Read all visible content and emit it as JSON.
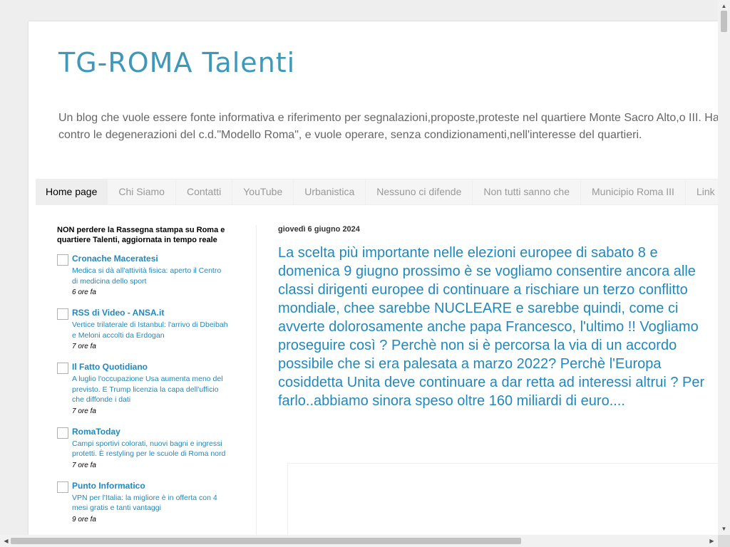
{
  "header": {
    "title": "TG-ROMA Talenti",
    "description": "Un blog che vuole essere fonte informativa e riferimento per segnalazioni,proposte,proteste nel quartiere Monte Sacro Alto,o III. Ha combattuto contro le degenerazioni del c.d.\"Modello Roma\", e vuole operare, senza condizionamenti,nell'interesse del quartieri."
  },
  "tabs": [
    {
      "label": "Home page"
    },
    {
      "label": "Chi Siamo"
    },
    {
      "label": "Contatti"
    },
    {
      "label": "YouTube"
    },
    {
      "label": "Urbanistica"
    },
    {
      "label": "Nessuno ci difende"
    },
    {
      "label": "Non tutti sanno che"
    },
    {
      "label": "Municipio Roma III"
    },
    {
      "label": "Link"
    }
  ],
  "sidebar": {
    "widget_title": "NON perdere la Rassegna stampa su Roma e quartiere Talenti, aggiornata in tempo reale",
    "feeds": [
      {
        "source": "Cronache Maceratesi",
        "link": "Medica si dà all'attività fisica: aperto il Centro di medicina dello sport",
        "time": "6 ore fa"
      },
      {
        "source": "RSS di Video - ANSA.it",
        "link": "Vertice trilaterale di Istanbul: l'arrivo di Dbeibah e Meloni accolti da Erdogan",
        "time": "7 ore fa"
      },
      {
        "source": "Il Fatto Quotidiano",
        "link": "A luglio l'occupazione Usa aumenta meno del previsto. E Trump licenzia la capa dell'ufficio che diffonde i dati",
        "time": "7 ore fa"
      },
      {
        "source": "RomaToday",
        "link": "Campi sportivi colorati, nuovi bagni e ingressi protetti. È restyling per le scuole di Roma nord",
        "time": "7 ore fa"
      },
      {
        "source": "Punto Informatico",
        "link": "VPN per l'Italia: la migliore è in offerta con 4 mesi gratis e tanti vantaggi",
        "time": "9 ore fa"
      }
    ]
  },
  "post": {
    "date": "giovedì 6 giugno 2024",
    "title": "La scelta più importante nelle elezioni europee di sabato 8 e domenica 9 giugno prossimo è se vogliamo consentire ancora alle classi dirigenti europee di continuare a rischiare un terzo conflitto mondiale, chee sarebbe NUCLEARE e sarebbe quindi, come ci avverte dolorosamente anche papa Francesco, l'ultimo !! Vogliamo proseguire così ? Perchè non si è percorsa la via di un accordo possibile che si era palesata a marzo 2022? Perchè l'Europa cosiddetta Unita deve continuare a dar retta ad interessi altrui ? Per farlo..abbiamo sinora speso oltre 160 miliardi di euro...."
  },
  "colors": {
    "title": "#3f98b8",
    "link": "#2288bb",
    "background": "#eeeeee"
  }
}
